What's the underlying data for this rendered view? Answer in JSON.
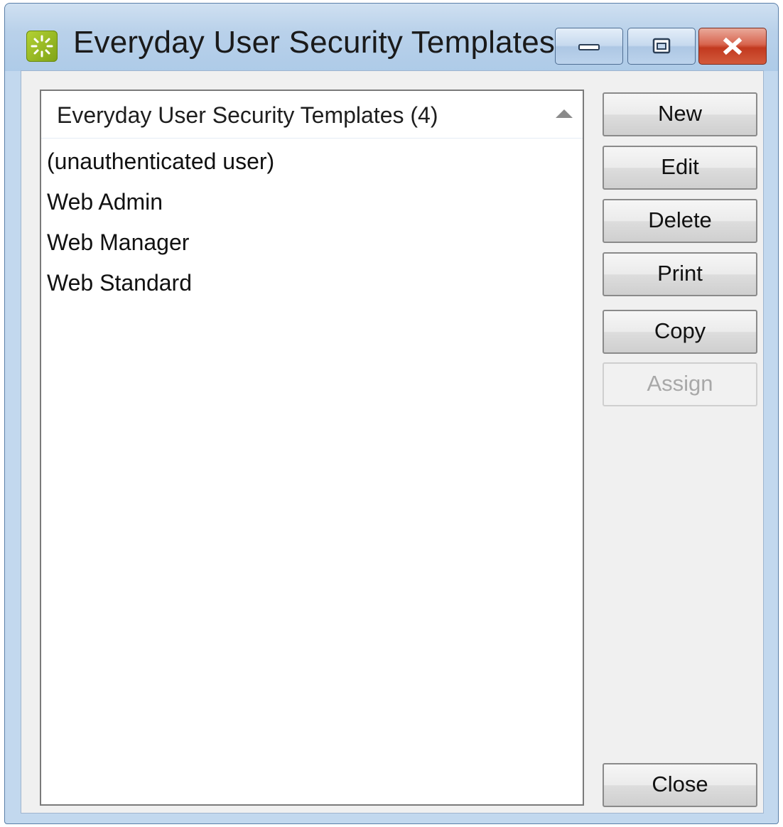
{
  "window": {
    "title": "Everyday User Security Templates",
    "caption_buttons": [
      "minimize",
      "maximize",
      "close"
    ]
  },
  "list": {
    "header": "Everyday User Security Templates (4)",
    "sort": "ascending",
    "items": [
      "(unauthenticated user)",
      "Web Admin",
      "Web Manager",
      "Web Standard"
    ]
  },
  "buttons": {
    "new": "New",
    "edit": "Edit",
    "delete": "Delete",
    "print": "Print",
    "copy": "Copy",
    "assign": "Assign",
    "close": "Close"
  },
  "states": {
    "assign_enabled": false
  },
  "colors": {
    "close_caption": "#c2391f",
    "app_icon": "#9dc02a"
  }
}
